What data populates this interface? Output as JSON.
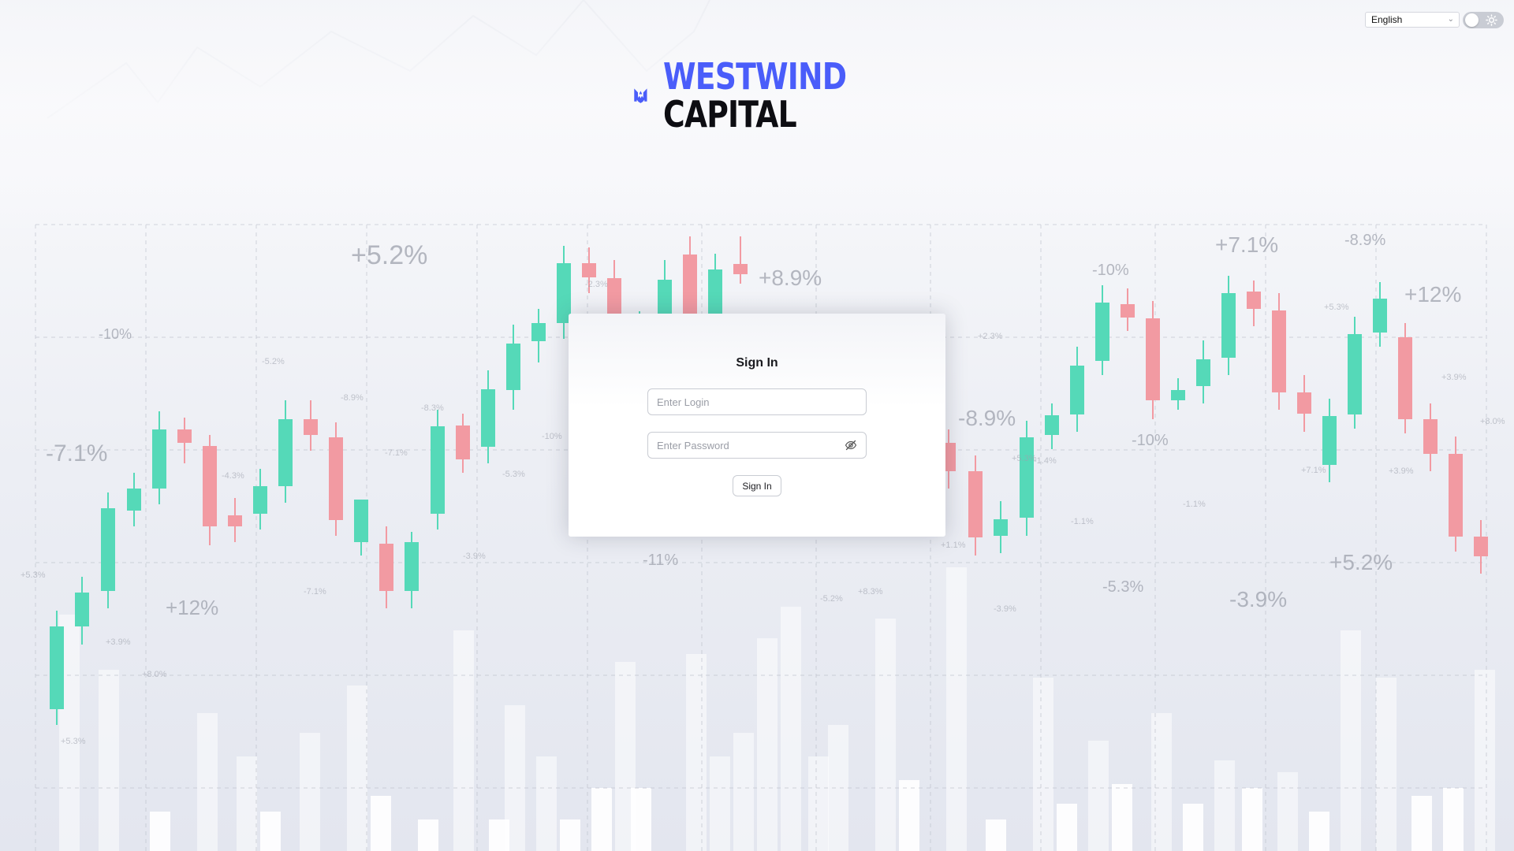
{
  "brand": {
    "line1": "WESTWIND",
    "line2": "CAPITAL",
    "accent_color": "#4a5dfa",
    "dark_color": "#0d0d12"
  },
  "header": {
    "language": "English",
    "language_chevron_icon": "chevron-down-icon",
    "theme_toggle": {
      "state": "light",
      "icon": "sun-icon"
    }
  },
  "signin": {
    "title": "Sign In",
    "login_placeholder": "Enter Login",
    "password_placeholder": "Enter Password",
    "password_toggle_icon": "eye-slash-icon",
    "submit_label": "Sign In"
  },
  "background": {
    "up_color": "#55d9b8",
    "down_color": "#f29aa2",
    "percent_labels": [
      "+5.2%",
      "-10%",
      "-7.1%",
      "+12%",
      "-5.2%",
      "-8.9%",
      "-8.3%",
      "+8.9%",
      "-2.3%",
      "+2.3%",
      "-10%",
      "+7.1%",
      "-8.9%",
      "+12%",
      "-8.9%",
      "-10%",
      "+5.2%",
      "-5.3%",
      "-3.9%",
      "-11%",
      "+5.3%",
      "+3.9%",
      "+8.0%",
      "-4.3%",
      "-7.1%",
      "-5.3%",
      "-3.9%",
      "-5.2%",
      "+8.3%",
      "-1.1%",
      "-3.9%",
      "+7.1%",
      "-1.1%",
      "+5.3%",
      "-1.4%",
      "+8.0%",
      "+3.9%",
      "+5.3%",
      "+5.3%",
      "-10%",
      "+1.1%",
      "-7.1%",
      "+3.9%"
    ]
  }
}
